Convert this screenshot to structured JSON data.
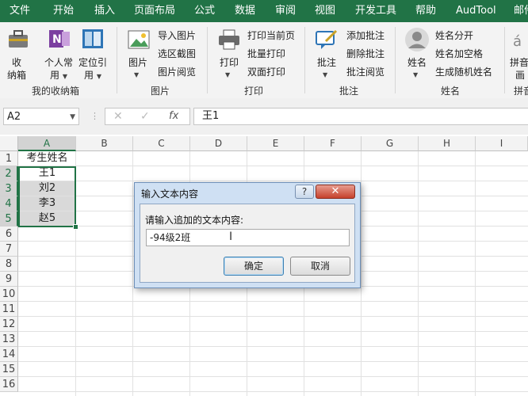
{
  "ribbon_tabs": [
    "文件",
    "开始",
    "插入",
    "页面布局",
    "公式",
    "数据",
    "审阅",
    "视图",
    "开发工具",
    "帮助",
    "AudTool",
    "邮件"
  ],
  "groups": {
    "favorites": {
      "label": "我的收纳箱",
      "btn1": "收",
      "btn1b": "纳箱",
      "btn2": "个人常",
      "btn2b": "用",
      "btn3": "定位引",
      "btn3b": "用"
    },
    "picture": {
      "label": "图片",
      "big": "图片",
      "items": [
        "导入图片",
        "选区截图",
        "图片阅览"
      ]
    },
    "print": {
      "label": "打印",
      "big": "打印",
      "items": [
        "打印当前页",
        "批量打印",
        "双面打印"
      ]
    },
    "comment": {
      "label": "批注",
      "big": "批注",
      "items": [
        "添加批注",
        "删除批注",
        "批注阅览"
      ]
    },
    "name": {
      "label": "姓名",
      "big": "姓名",
      "items": [
        "姓名分开",
        "姓名加空格",
        "生成随机姓名"
      ]
    },
    "pinyin": {
      "label": "拼音",
      "big1": "拼音",
      "big2": "画"
    }
  },
  "formula_bar": {
    "name_box": "A2",
    "content": "王1",
    "fx": "fx"
  },
  "columns": [
    "A",
    "B",
    "C",
    "D",
    "E",
    "F",
    "G",
    "H",
    "I"
  ],
  "rows": [
    "1",
    "2",
    "3",
    "4",
    "5",
    "6",
    "7",
    "8",
    "9",
    "10",
    "11",
    "12",
    "13",
    "14",
    "15",
    "16"
  ],
  "cells": {
    "a1": "考生姓名",
    "a2": "王1",
    "a3": "刘2",
    "a4": "李3",
    "a5": "赵5"
  },
  "dialog": {
    "title": "输入文本内容",
    "help": "?",
    "close": "✕",
    "prompt": "请输入追加的文本内容:",
    "input_value": "-94级2班",
    "ok": "确定",
    "cancel": "取消"
  },
  "colors": {
    "excel_green": "#217346",
    "dialog_frame": "#cfe0f3",
    "close_red": "#c6412c"
  }
}
